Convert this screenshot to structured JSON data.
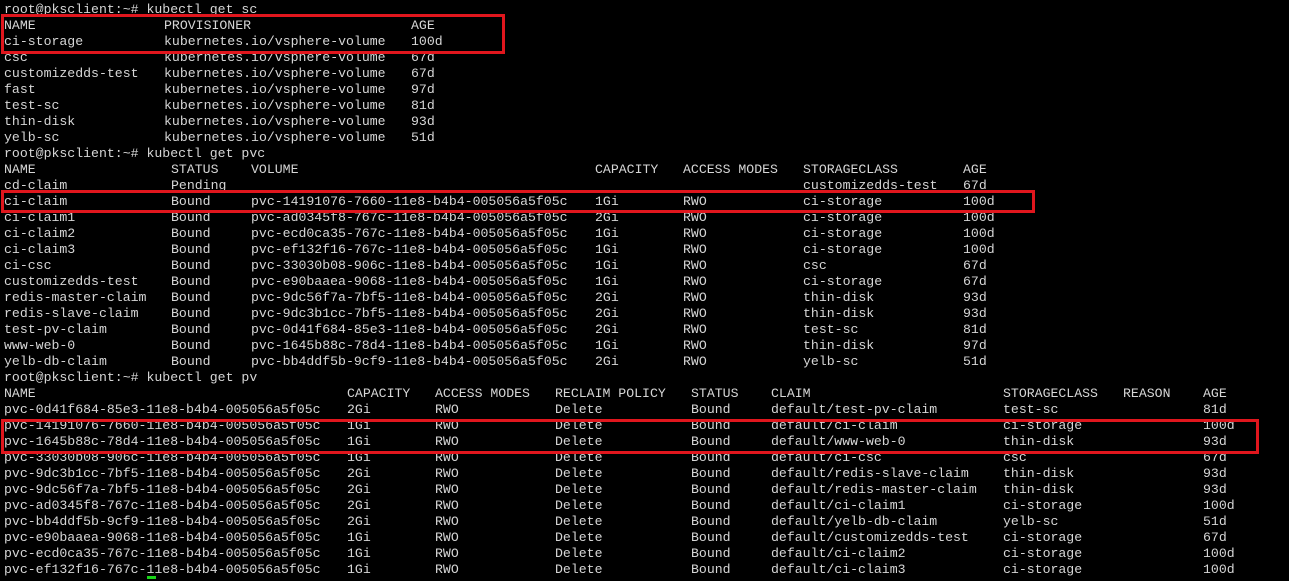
{
  "terminal": {
    "prompt": "root@pksclient:~# ",
    "sections": [
      {
        "command": "kubectl get sc",
        "headers": [
          "NAME",
          "PROVISIONER",
          "AGE"
        ],
        "rows": [
          [
            "ci-storage",
            "kubernetes.io/vsphere-volume",
            "100d"
          ],
          [
            "csc",
            "kubernetes.io/vsphere-volume",
            "67d"
          ],
          [
            "customizedds-test",
            "kubernetes.io/vsphere-volume",
            "67d"
          ],
          [
            "fast",
            "kubernetes.io/vsphere-volume",
            "97d"
          ],
          [
            "test-sc",
            "kubernetes.io/vsphere-volume",
            "81d"
          ],
          [
            "thin-disk",
            "kubernetes.io/vsphere-volume",
            "93d"
          ],
          [
            "yelb-sc",
            "kubernetes.io/vsphere-volume",
            "51d"
          ]
        ]
      },
      {
        "command": "kubectl get pvc",
        "headers": [
          "NAME",
          "STATUS",
          "VOLUME",
          "CAPACITY",
          "ACCESS MODES",
          "STORAGECLASS",
          "AGE"
        ],
        "rows": [
          [
            "cd-claim",
            "Pending",
            "",
            "",
            "",
            "customizedds-test",
            "67d"
          ],
          [
            "ci-claim",
            "Bound",
            "pvc-14191076-7660-11e8-b4b4-005056a5f05c",
            "1Gi",
            "RWO",
            "ci-storage",
            "100d"
          ],
          [
            "ci-claim1",
            "Bound",
            "pvc-ad0345f8-767c-11e8-b4b4-005056a5f05c",
            "2Gi",
            "RWO",
            "ci-storage",
            "100d"
          ],
          [
            "ci-claim2",
            "Bound",
            "pvc-ecd0ca35-767c-11e8-b4b4-005056a5f05c",
            "1Gi",
            "RWO",
            "ci-storage",
            "100d"
          ],
          [
            "ci-claim3",
            "Bound",
            "pvc-ef132f16-767c-11e8-b4b4-005056a5f05c",
            "1Gi",
            "RWO",
            "ci-storage",
            "100d"
          ],
          [
            "ci-csc",
            "Bound",
            "pvc-33030b08-906c-11e8-b4b4-005056a5f05c",
            "1Gi",
            "RWO",
            "csc",
            "67d"
          ],
          [
            "customizedds-test",
            "Bound",
            "pvc-e90baaea-9068-11e8-b4b4-005056a5f05c",
            "1Gi",
            "RWO",
            "ci-storage",
            "67d"
          ],
          [
            "redis-master-claim",
            "Bound",
            "pvc-9dc56f7a-7bf5-11e8-b4b4-005056a5f05c",
            "2Gi",
            "RWO",
            "thin-disk",
            "93d"
          ],
          [
            "redis-slave-claim",
            "Bound",
            "pvc-9dc3b1cc-7bf5-11e8-b4b4-005056a5f05c",
            "2Gi",
            "RWO",
            "thin-disk",
            "93d"
          ],
          [
            "test-pv-claim",
            "Bound",
            "pvc-0d41f684-85e3-11e8-b4b4-005056a5f05c",
            "2Gi",
            "RWO",
            "test-sc",
            "81d"
          ],
          [
            "www-web-0",
            "Bound",
            "pvc-1645b88c-78d4-11e8-b4b4-005056a5f05c",
            "1Gi",
            "RWO",
            "thin-disk",
            "97d"
          ],
          [
            "yelb-db-claim",
            "Bound",
            "pvc-bb4ddf5b-9cf9-11e8-b4b4-005056a5f05c",
            "2Gi",
            "RWO",
            "yelb-sc",
            "51d"
          ]
        ]
      },
      {
        "command": "kubectl get pv",
        "headers": [
          "NAME",
          "CAPACITY",
          "ACCESS MODES",
          "RECLAIM POLICY",
          "STATUS",
          "CLAIM",
          "STORAGECLASS",
          "REASON",
          "AGE"
        ],
        "rows": [
          [
            "pvc-0d41f684-85e3-11e8-b4b4-005056a5f05c",
            "2Gi",
            "RWO",
            "Delete",
            "Bound",
            "default/test-pv-claim",
            "test-sc",
            "",
            "81d"
          ],
          [
            "pvc-14191076-7660-11e8-b4b4-005056a5f05c",
            "1Gi",
            "RWO",
            "Delete",
            "Bound",
            "default/ci-claim",
            "ci-storage",
            "",
            "100d"
          ],
          [
            "pvc-1645b88c-78d4-11e8-b4b4-005056a5f05c",
            "1Gi",
            "RWO",
            "Delete",
            "Bound",
            "default/www-web-0",
            "thin-disk",
            "",
            "93d"
          ],
          [
            "pvc-33030b08-906c-11e8-b4b4-005056a5f05c",
            "1Gi",
            "RWO",
            "Delete",
            "Bound",
            "default/ci-csc",
            "csc",
            "",
            "67d"
          ],
          [
            "pvc-9dc3b1cc-7bf5-11e8-b4b4-005056a5f05c",
            "2Gi",
            "RWO",
            "Delete",
            "Bound",
            "default/redis-slave-claim",
            "thin-disk",
            "",
            "93d"
          ],
          [
            "pvc-9dc56f7a-7bf5-11e8-b4b4-005056a5f05c",
            "2Gi",
            "RWO",
            "Delete",
            "Bound",
            "default/redis-master-claim",
            "thin-disk",
            "",
            "93d"
          ],
          [
            "pvc-ad0345f8-767c-11e8-b4b4-005056a5f05c",
            "2Gi",
            "RWO",
            "Delete",
            "Bound",
            "default/ci-claim1",
            "ci-storage",
            "",
            "100d"
          ],
          [
            "pvc-bb4ddf5b-9cf9-11e8-b4b4-005056a5f05c",
            "2Gi",
            "RWO",
            "Delete",
            "Bound",
            "default/yelb-db-claim",
            "yelb-sc",
            "",
            "51d"
          ],
          [
            "pvc-e90baaea-9068-11e8-b4b4-005056a5f05c",
            "1Gi",
            "RWO",
            "Delete",
            "Bound",
            "default/customizedds-test",
            "ci-storage",
            "",
            "67d"
          ],
          [
            "pvc-ecd0ca35-767c-11e8-b4b4-005056a5f05c",
            "1Gi",
            "RWO",
            "Delete",
            "Bound",
            "default/ci-claim2",
            "ci-storage",
            "",
            "100d"
          ],
          [
            "pvc-ef132f16-767c-11e8-b4b4-005056a5f05c",
            "1Gi",
            "RWO",
            "Delete",
            "Bound",
            "default/ci-claim3",
            "ci-storage",
            "",
            "100d"
          ]
        ]
      }
    ]
  },
  "colors": {
    "background": "#000000",
    "text": "#d6d6d6",
    "highlight": "#e0161d",
    "cursor": "#18d418"
  }
}
